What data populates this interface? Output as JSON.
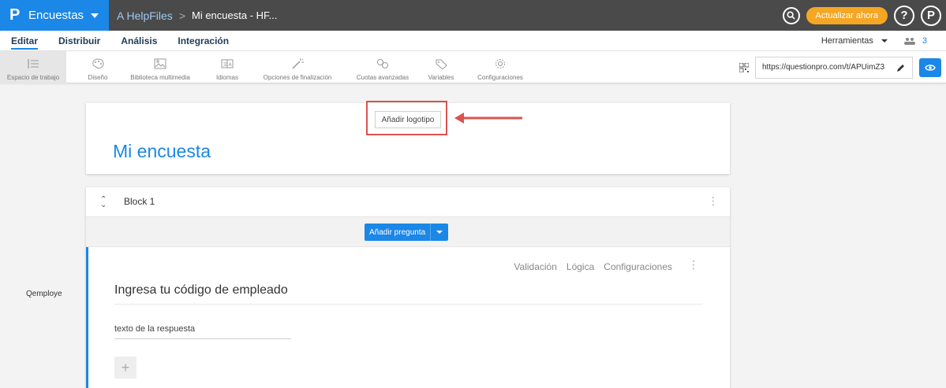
{
  "topbar": {
    "logo": "P",
    "app_name": "Encuestas",
    "breadcrumb_parent": "A HelpFiles",
    "breadcrumb_separator": ">",
    "breadcrumb_current": "Mi encuesta - HF...",
    "upgrade_label": "Actualizar ahora",
    "help_label": "?",
    "profile_label": "P"
  },
  "menu": {
    "items": [
      {
        "label": "Editar"
      },
      {
        "label": "Distribuir"
      },
      {
        "label": "Análisis"
      },
      {
        "label": "Integración"
      }
    ],
    "tools_label": "Herramientas",
    "user_count": "3"
  },
  "toolbar": {
    "items": [
      {
        "label": "Espacio de trabajo",
        "icon": "workspace-icon"
      },
      {
        "label": "Diseño",
        "icon": "palette-icon"
      },
      {
        "label": "Biblioteca multimedia",
        "icon": "image-icon"
      },
      {
        "label": "Idiomas",
        "icon": "language-icon"
      },
      {
        "label": "Opciones de finalización",
        "icon": "wand-icon"
      },
      {
        "label": "Cuotas avanzadas",
        "icon": "quota-icon"
      },
      {
        "label": "Variables",
        "icon": "tag-icon"
      },
      {
        "label": "Configuraciones",
        "icon": "gear-icon"
      }
    ],
    "survey_url": "https://questionpro.com/t/APUimZ3"
  },
  "header": {
    "add_logo_label": "Añadir logotipo",
    "survey_title": "Mi encuesta"
  },
  "block": {
    "title": "Block 1",
    "add_question_label": "Añadir pregunta"
  },
  "question": {
    "actions": [
      "Validación",
      "Lógica",
      "Configuraciones"
    ],
    "text": "Ingresa tu código de empleado",
    "answer_placeholder": "texto de la respuesta",
    "add_label": "+",
    "side_label": "Qemploye"
  },
  "colors": {
    "brand_blue": "#1b87e6",
    "topbar_gray": "#4a4a4a",
    "upgrade_orange": "#f5a623",
    "highlight_red": "#d9534f"
  }
}
